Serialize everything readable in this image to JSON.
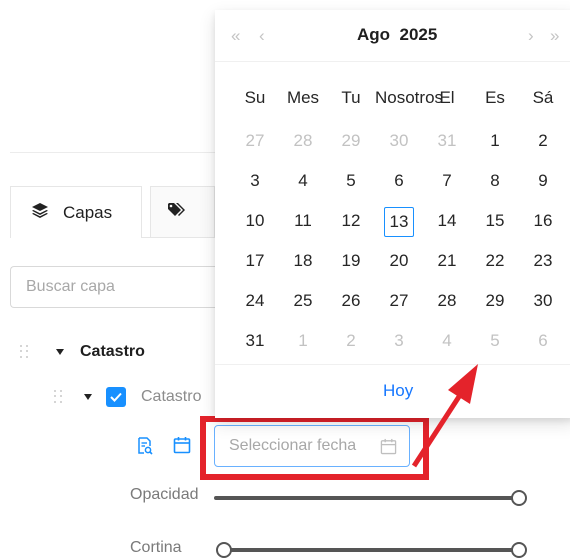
{
  "tabs": {
    "layers_label": "Capas"
  },
  "search": {
    "placeholder": "Buscar capa"
  },
  "tree": {
    "group_label": "Catastro",
    "layer_label": "Catastro"
  },
  "date_field": {
    "placeholder": "Seleccionar fecha"
  },
  "sliders": {
    "opacity_label": "Opacidad",
    "curtain_label": "Cortina"
  },
  "calendar": {
    "month": "Ago",
    "year": "2025",
    "weekdays": [
      "Su",
      "Mes",
      "Tu",
      "Nosotros",
      "El",
      "Es",
      "Sá"
    ],
    "days": [
      {
        "n": "27",
        "muted": true
      },
      {
        "n": "28",
        "muted": true
      },
      {
        "n": "29",
        "muted": true
      },
      {
        "n": "30",
        "muted": true
      },
      {
        "n": "31",
        "muted": true
      },
      {
        "n": "1"
      },
      {
        "n": "2"
      },
      {
        "n": "3"
      },
      {
        "n": "4"
      },
      {
        "n": "5"
      },
      {
        "n": "6"
      },
      {
        "n": "7"
      },
      {
        "n": "8"
      },
      {
        "n": "9"
      },
      {
        "n": "10"
      },
      {
        "n": "11"
      },
      {
        "n": "12"
      },
      {
        "n": "13",
        "today": true
      },
      {
        "n": "14"
      },
      {
        "n": "15"
      },
      {
        "n": "16"
      },
      {
        "n": "17"
      },
      {
        "n": "18"
      },
      {
        "n": "19"
      },
      {
        "n": "20"
      },
      {
        "n": "21"
      },
      {
        "n": "22"
      },
      {
        "n": "23"
      },
      {
        "n": "24"
      },
      {
        "n": "25"
      },
      {
        "n": "26"
      },
      {
        "n": "27"
      },
      {
        "n": "28"
      },
      {
        "n": "29"
      },
      {
        "n": "30"
      },
      {
        "n": "31"
      },
      {
        "n": "1",
        "muted": true
      },
      {
        "n": "2",
        "muted": true
      },
      {
        "n": "3",
        "muted": true
      },
      {
        "n": "4",
        "muted": true
      },
      {
        "n": "5",
        "muted": true
      },
      {
        "n": "6",
        "muted": true
      }
    ],
    "today_label": "Hoy"
  },
  "colors": {
    "accent": "#1890ff",
    "highlight": "#e4232b",
    "muted": "#c2c2c2"
  },
  "icons": {
    "tab_layers": "layers-icon",
    "tab_tags": "tags-icon",
    "layer_info": "search-document-icon",
    "layer_date": "calendar-icon",
    "date_field": "calendar-icon"
  }
}
